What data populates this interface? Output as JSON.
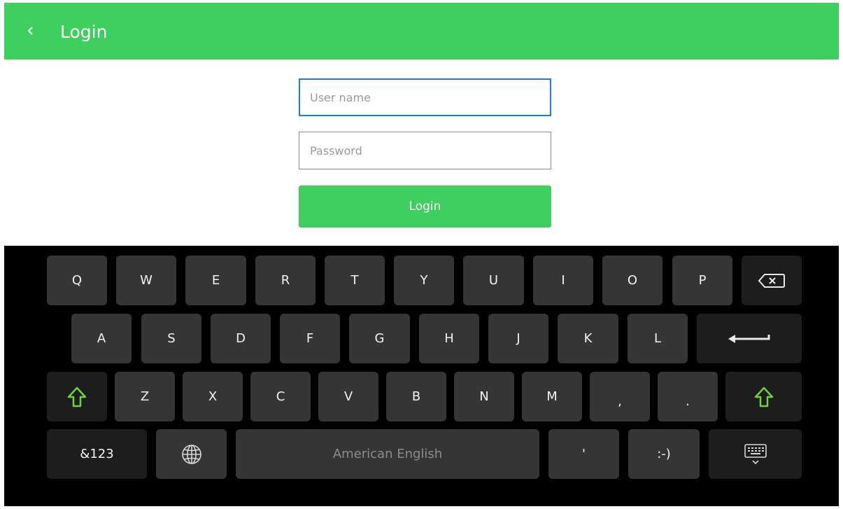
{
  "header": {
    "title": "Login",
    "back_icon": "chevron-left-icon",
    "background_color": "#3ecf5e"
  },
  "form": {
    "username": {
      "value": "",
      "placeholder": "User name"
    },
    "password": {
      "value": "",
      "placeholder": "Password"
    },
    "login_label": "Login",
    "accent_color": "#3ecf5e",
    "focus_color": "#1c7ed6"
  },
  "keyboard": {
    "row1": [
      "Q",
      "W",
      "E",
      "R",
      "T",
      "Y",
      "U",
      "I",
      "O",
      "P"
    ],
    "backspace_icon": "backspace-icon",
    "row2": [
      "A",
      "S",
      "D",
      "F",
      "G",
      "H",
      "J",
      "K",
      "L"
    ],
    "enter_icon": "enter-arrow-icon",
    "row3": [
      "Z",
      "X",
      "C",
      "V",
      "B",
      "N",
      "M",
      ",",
      "."
    ],
    "shift_icon": "shift-arrow-icon",
    "symbols_label": "&123",
    "globe_icon": "globe-icon",
    "space_label": "American English",
    "apostrophe_label": "'",
    "emoticon_label": ":-)",
    "hide_keyboard_icon": "hide-keyboard-icon",
    "key_color": "#353535",
    "dark_key_color": "#1d1d1d",
    "shift_color": "#6ed33a"
  }
}
